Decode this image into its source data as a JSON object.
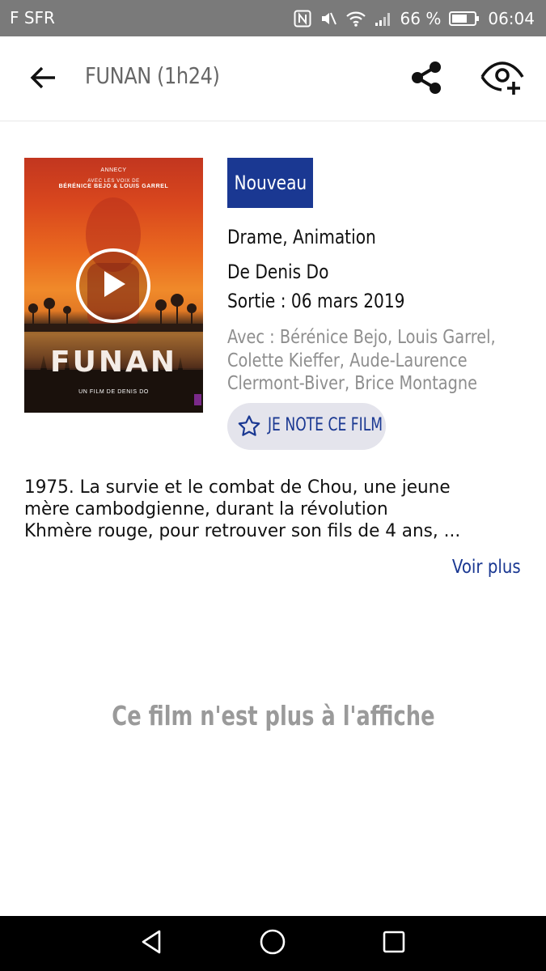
{
  "status_bar": {
    "carrier": "F SFR",
    "battery": "66 %",
    "time": "06:04"
  },
  "app_bar": {
    "title": "FUNAN (1h24)"
  },
  "poster": {
    "festival_logo": "ANNECY",
    "cast_line_1": "AVEC LES VOIX DE",
    "cast_line_2": "BÉRÉNICE BEJO & LOUIS GARREL",
    "title": "FUNAN",
    "director_credit": "UN FILM DE DENIS DO"
  },
  "movie": {
    "badge": "Nouveau",
    "genre": "Drame, Animation",
    "director": "De Denis Do",
    "release": "Sortie : 06 mars 2019",
    "cast_lines": [
      "Avec : Bérénice Bejo, Louis Garrel,",
      "Colette Kieffer, Aude-Laurence",
      "Clermont-Biver, Brice Montagne"
    ],
    "rate_label": "JE NOTE CE FILM"
  },
  "synopsis": {
    "lines": [
      "1975. La survie et le combat de Chou, une jeune",
      "mère cambodgienne, durant la révolution",
      "Khmère rouge, pour retrouver son fils de 4 ans, ..."
    ],
    "see_more": "Voir plus"
  },
  "availability": "Ce film n'est plus à l'affiche",
  "colors": {
    "brand_blue": "#1a3892",
    "status_bar": "#7a7a7a",
    "muted_text": "#8e8e8e"
  },
  "icons": {
    "back": "arrow-left-icon",
    "share": "share-icon",
    "watchlist": "eye-plus-icon",
    "play": "play-icon",
    "rate": "star-outline-icon"
  }
}
